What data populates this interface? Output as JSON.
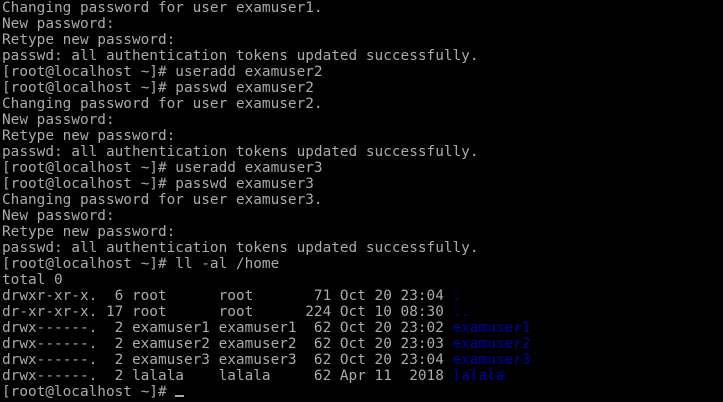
{
  "colors": {
    "background": "#000000",
    "foreground": "#aaaaaa",
    "directory": "#0000aa"
  },
  "history_top": [
    "Changing password for user examuser1.",
    "New password:",
    "Retype new password:",
    "passwd: all authentication tokens updated successfully.",
    "[root@localhost ~]# useradd examuser2",
    "[root@localhost ~]# passwd examuser2",
    "Changing password for user examuser2.",
    "New password:",
    "Retype new password:",
    "passwd: all authentication tokens updated successfully.",
    "[root@localhost ~]# useradd examuser3",
    "[root@localhost ~]# passwd examuser3",
    "Changing password for user examuser3.",
    "New password:",
    "Retype new password:",
    "passwd: all authentication tokens updated successfully.",
    "[root@localhost ~]# ll -al /home",
    "total 0"
  ],
  "listing": [
    {
      "meta": "drwxr-xr-x.  6 root      root       71 Oct 20 23:04 ",
      "name": "."
    },
    {
      "meta": "dr-xr-xr-x. 17 root      root      224 Oct 10 08:30 ",
      "name": ".."
    },
    {
      "meta": "drwx------.  2 examuser1 examuser1  62 Oct 20 23:02 ",
      "name": "examuser1"
    },
    {
      "meta": "drwx------.  2 examuser2 examuser2  62 Oct 20 23:03 ",
      "name": "examuser2"
    },
    {
      "meta": "drwx------.  2 examuser3 examuser3  62 Oct 20 23:04 ",
      "name": "examuser3"
    },
    {
      "meta": "drwx------.  2 lalala    lalala     62 Apr 11  2018 ",
      "name": "lalala"
    }
  ],
  "prompt": "[root@localhost ~]# "
}
